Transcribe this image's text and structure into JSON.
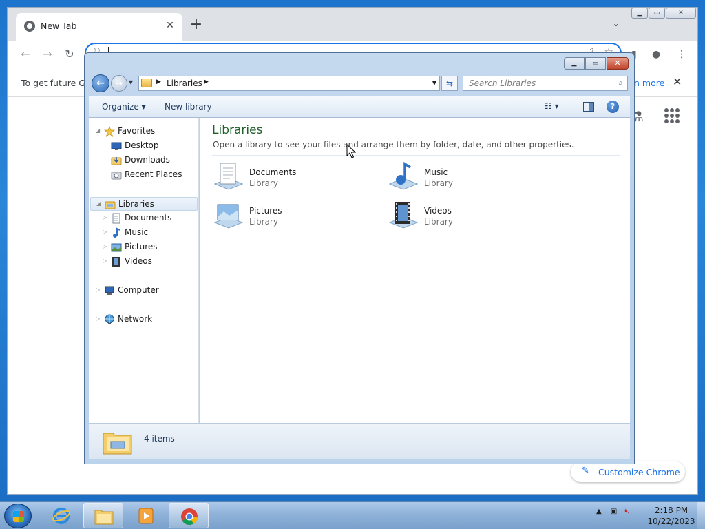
{
  "chrome": {
    "tab_title": "New Tab",
    "tab_close": "✕",
    "new_tab": "+",
    "tab_search": "⌄",
    "infobar_message": "To get future Go",
    "infobar_link": "n more",
    "infobar_close": "✕",
    "customize_label": "Customize Chrome",
    "window_controls": {
      "min": "▁",
      "max": "▭",
      "close": "✕"
    }
  },
  "explorer": {
    "caption": {
      "min": "▁",
      "max": "▭",
      "close": "✕"
    },
    "breadcrumb": "Libraries",
    "search_placeholder": "Search Libraries",
    "toolbar": {
      "organize": "Organize ▾",
      "new_library": "New library",
      "views": "☷ ▾",
      "help": "?"
    },
    "nav": {
      "favorites": "Favorites",
      "desktop": "Desktop",
      "downloads": "Downloads",
      "recent": "Recent Places",
      "libraries": "Libraries",
      "documents": "Documents",
      "music": "Music",
      "pictures": "Pictures",
      "videos": "Videos",
      "computer": "Computer",
      "network": "Network"
    },
    "heading": "Libraries",
    "subheading": "Open a library to see your files and arrange them by folder, date, and other properties.",
    "libraries": [
      {
        "name": "Documents",
        "type": "Library"
      },
      {
        "name": "Music",
        "type": "Library"
      },
      {
        "name": "Pictures",
        "type": "Library"
      },
      {
        "name": "Videos",
        "type": "Library"
      }
    ],
    "item_count": "4 items"
  },
  "taskbar": {
    "time": "2:18 PM",
    "date": "10/22/2023"
  },
  "colors": {
    "accent": "#1a73e8",
    "heading_green": "#1e5f2a",
    "desktop_blue": "#1d74cc"
  }
}
